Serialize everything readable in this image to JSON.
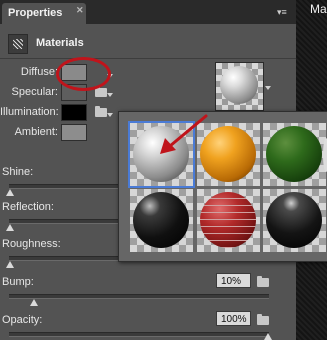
{
  "backdrop": {
    "text": "Ma"
  },
  "panel": {
    "tab_label": "Properties",
    "tab_close": "✕",
    "menu_glyph": "▾≡",
    "header_title": "Materials"
  },
  "fields": {
    "diffuse": {
      "label": "Diffuse:",
      "color": "#8a8a8a"
    },
    "specular": {
      "label": "Specular:",
      "color": "#5e5e5e"
    },
    "illumination": {
      "label": "Illumination:",
      "color": "#000000"
    },
    "ambient": {
      "label": "Ambient:",
      "color": "#8d8d8d"
    }
  },
  "sliders": [
    {
      "label": "Shine:",
      "value_fraction": 0.0
    },
    {
      "label": "Reflection:",
      "value_fraction": 0.0
    },
    {
      "label": "Roughness:",
      "value_fraction": 0.0
    },
    {
      "label": "Bump:",
      "value": "10%",
      "value_fraction": 0.1
    },
    {
      "label": "Opacity:",
      "value": "100%",
      "value_fraction": 1.0
    }
  ],
  "materials_picker": {
    "items": [
      "default",
      "orange",
      "green",
      "black",
      "brick",
      "gloss"
    ],
    "selected": "default"
  },
  "colors": {
    "highlight": "#c0141b",
    "selection": "#4a7bd6"
  }
}
